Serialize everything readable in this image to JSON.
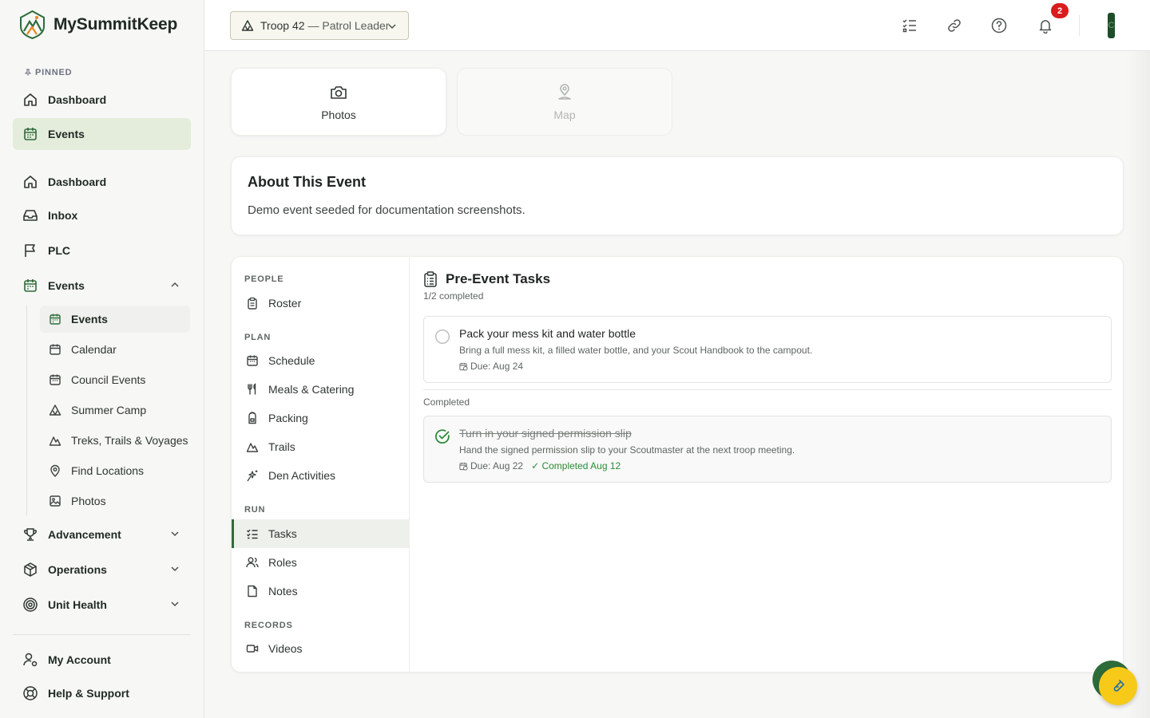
{
  "app": {
    "name": "MySummitKeep"
  },
  "sidebar": {
    "pinned_label": "PINNED",
    "pinned": [
      {
        "label": "Dashboard",
        "icon": "home-icon"
      },
      {
        "label": "Events",
        "icon": "calendar-icon",
        "active": true
      }
    ],
    "items": [
      {
        "label": "Dashboard",
        "icon": "home-icon"
      },
      {
        "label": "Inbox",
        "icon": "inbox-icon"
      },
      {
        "label": "PLC",
        "icon": "flag-icon"
      },
      {
        "label": "Events",
        "icon": "calendar-icon",
        "expanded": true
      }
    ],
    "events_sub": [
      {
        "label": "Events",
        "icon": "calendar-icon",
        "active": true
      },
      {
        "label": "Calendar",
        "icon": "calendar-icon"
      },
      {
        "label": "Council Events",
        "icon": "calendar-icon"
      },
      {
        "label": "Summer Camp",
        "icon": "tent-icon"
      },
      {
        "label": "Treks, Trails & Voyages",
        "icon": "mountain-icon"
      },
      {
        "label": "Find Locations",
        "icon": "map-pin-icon"
      },
      {
        "label": "Photos",
        "icon": "image-icon"
      }
    ],
    "groups": [
      {
        "label": "Advancement",
        "icon": "trophy-icon"
      },
      {
        "label": "Operations",
        "icon": "box-icon"
      },
      {
        "label": "Unit Health",
        "icon": "target-icon"
      }
    ],
    "footer": [
      {
        "label": "My Account",
        "icon": "user-gear-icon"
      },
      {
        "label": "Help & Support",
        "icon": "lifebuoy-icon"
      }
    ]
  },
  "header": {
    "troop": "Troop 42",
    "role": "— Patrol Leader",
    "notifications_count": "2",
    "avatar_initial": "C"
  },
  "tiles": [
    {
      "label": "Photos",
      "icon": "camera-icon",
      "enabled": true
    },
    {
      "label": "Map",
      "icon": "map-pin-icon",
      "enabled": false
    }
  ],
  "about": {
    "title": "About This Event",
    "description": "Demo event seeded for documentation screenshots."
  },
  "subnav": {
    "sections": [
      {
        "label": "PEOPLE",
        "items": [
          {
            "label": "Roster",
            "icon": "clipboard-icon"
          }
        ]
      },
      {
        "label": "PLAN",
        "items": [
          {
            "label": "Schedule",
            "icon": "calendar-icon"
          },
          {
            "label": "Meals & Catering",
            "icon": "utensils-icon"
          },
          {
            "label": "Packing",
            "icon": "backpack-icon"
          },
          {
            "label": "Trails",
            "icon": "mountain-icon"
          },
          {
            "label": "Den Activities",
            "icon": "sparkles-icon"
          }
        ]
      },
      {
        "label": "RUN",
        "items": [
          {
            "label": "Tasks",
            "icon": "checklist-icon",
            "active": true
          },
          {
            "label": "Roles",
            "icon": "users-icon"
          },
          {
            "label": "Notes",
            "icon": "file-icon"
          }
        ]
      },
      {
        "label": "RECORDS",
        "items": [
          {
            "label": "Videos",
            "icon": "video-icon"
          }
        ]
      }
    ]
  },
  "tasks": {
    "title": "Pre-Event Tasks",
    "count": "1/2 completed",
    "open": [
      {
        "title": "Pack your mess kit and water bottle",
        "description": "Bring a full mess kit, a filled water bottle, and your Scout Handbook to the campout.",
        "due": "Due: Aug 24"
      }
    ],
    "completed_label": "Completed",
    "completed": [
      {
        "title": "Turn in your signed permission slip",
        "description": "Hand the signed permission slip to your Scoutmaster at the next troop meeting.",
        "due": "Due: Aug 22",
        "completed": "✓ Completed Aug 12"
      }
    ]
  },
  "colors": {
    "brand": "#2e6b3a",
    "accent": "#f7c919",
    "badge": "#d91c1c",
    "active_bg": "#e4ecdc"
  }
}
